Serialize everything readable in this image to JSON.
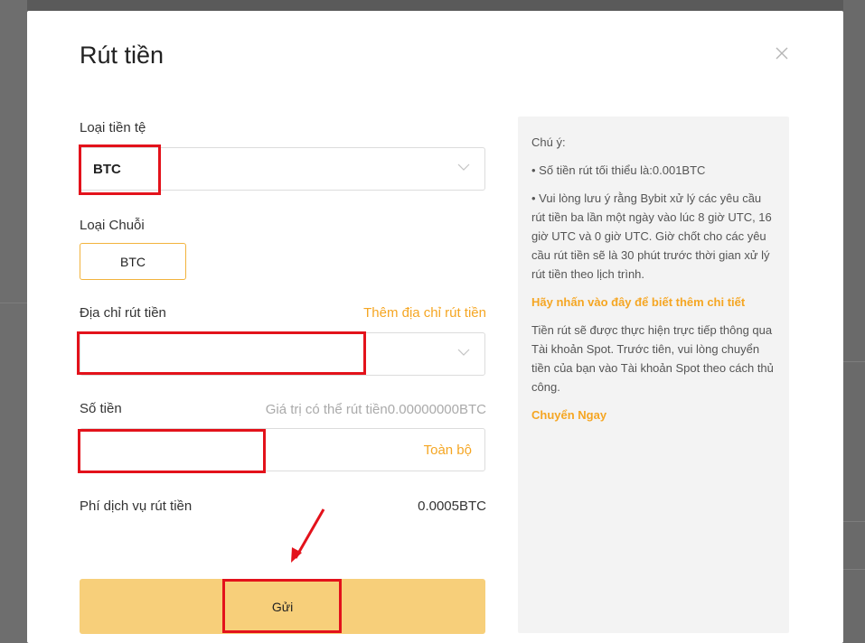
{
  "modal": {
    "title": "Rút tiền"
  },
  "form": {
    "currency": {
      "label": "Loại tiền tệ",
      "value": "BTC"
    },
    "chain": {
      "label": "Loại Chuỗi",
      "option": "BTC"
    },
    "address": {
      "label": "Địa chỉ rút tiền",
      "add_link": "Thêm địa chỉ rút tiền",
      "value": ""
    },
    "amount": {
      "label": "Số tiền",
      "available": "Giá trị có thể rút tiền0.00000000BTC",
      "value": "",
      "all_button": "Toàn bộ"
    },
    "fee": {
      "label": "Phí dịch vụ rút tiền",
      "value": "0.0005BTC"
    },
    "submit_label": "Gửi"
  },
  "notice": {
    "heading": "Chú ý:",
    "min_amount": "• Số tiền rút tối thiểu là:0.001BTC",
    "schedule": "• Vui lòng lưu ý rằng Bybit xử lý các yêu cầu rút tiền ba lần một ngày vào lúc 8 giờ UTC, 16 giờ UTC và 0 giờ UTC. Giờ chốt cho các yêu cầu rút tiền sẽ là 30 phút trước thời gian xử lý rút tiền theo lịch trình.",
    "details_link": "Hãy nhấn vào đây để biết thêm chi tiết",
    "spot_info": "Tiền rút sẽ được thực hiện trực tiếp thông qua Tài khoản Spot. Trước tiên, vui lòng chuyển tiền của bạn vào Tài khoản Spot theo cách thủ công.",
    "transfer_link": "Chuyển Ngay"
  },
  "colors": {
    "accent": "#f5a623",
    "submit_bg": "#f7cf7a",
    "highlight": "#e3121b"
  }
}
